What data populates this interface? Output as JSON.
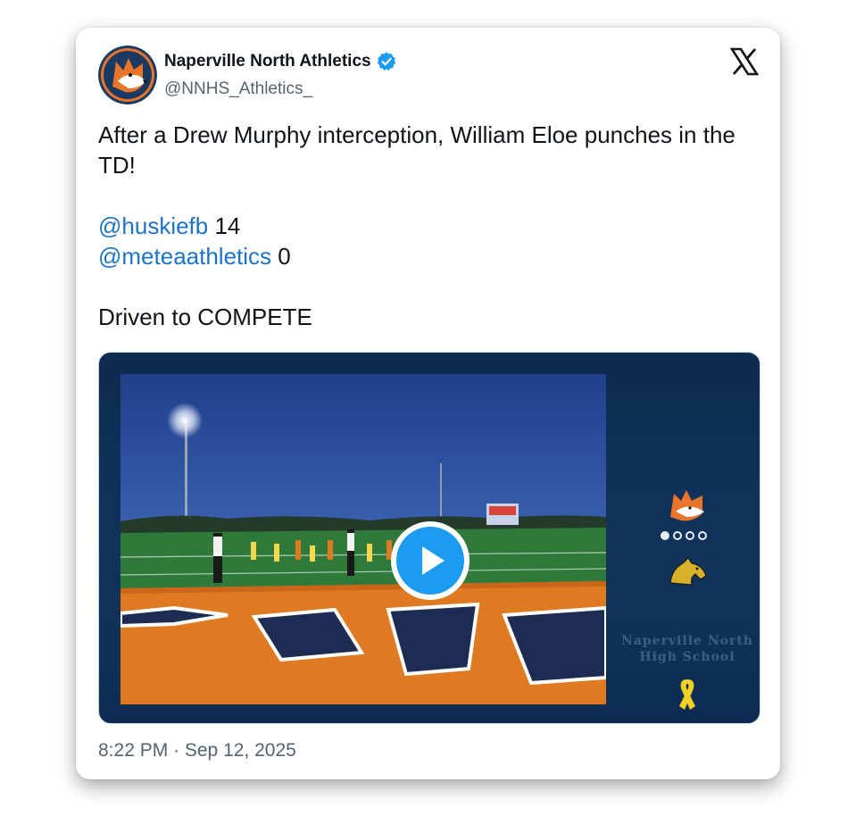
{
  "author": {
    "display_name": "Naperville North Athletics",
    "handle": "@NNHS_Athletics_",
    "verified": true,
    "avatar_icon": "husky-mascot-icon"
  },
  "platform_icon": "x-logo-icon",
  "tweet": {
    "line1": "After a Drew Murphy interception, William Eloe punches in the TD!",
    "score1_mention": "@huskiefb",
    "score1_value": " 14",
    "score2_mention": "@meteaathletics",
    "score2_value": " 0",
    "closing": "Driven to COMPETE"
  },
  "media": {
    "type": "video",
    "play_icon": "play-icon",
    "overlay_icons": [
      "husky-logo-icon",
      "dots-icon",
      "mustang-logo-icon",
      "yellow-ribbon-icon"
    ],
    "overlay_text_line1": "Naperville North",
    "overlay_text_line2": "High School"
  },
  "timestamp": "8:22 PM · Sep 12, 2025",
  "colors": {
    "mention": "#1d74c6",
    "verified": "#1d9bf0",
    "play_button": "#1d9bf0",
    "media_background": "#0d2b4e"
  }
}
